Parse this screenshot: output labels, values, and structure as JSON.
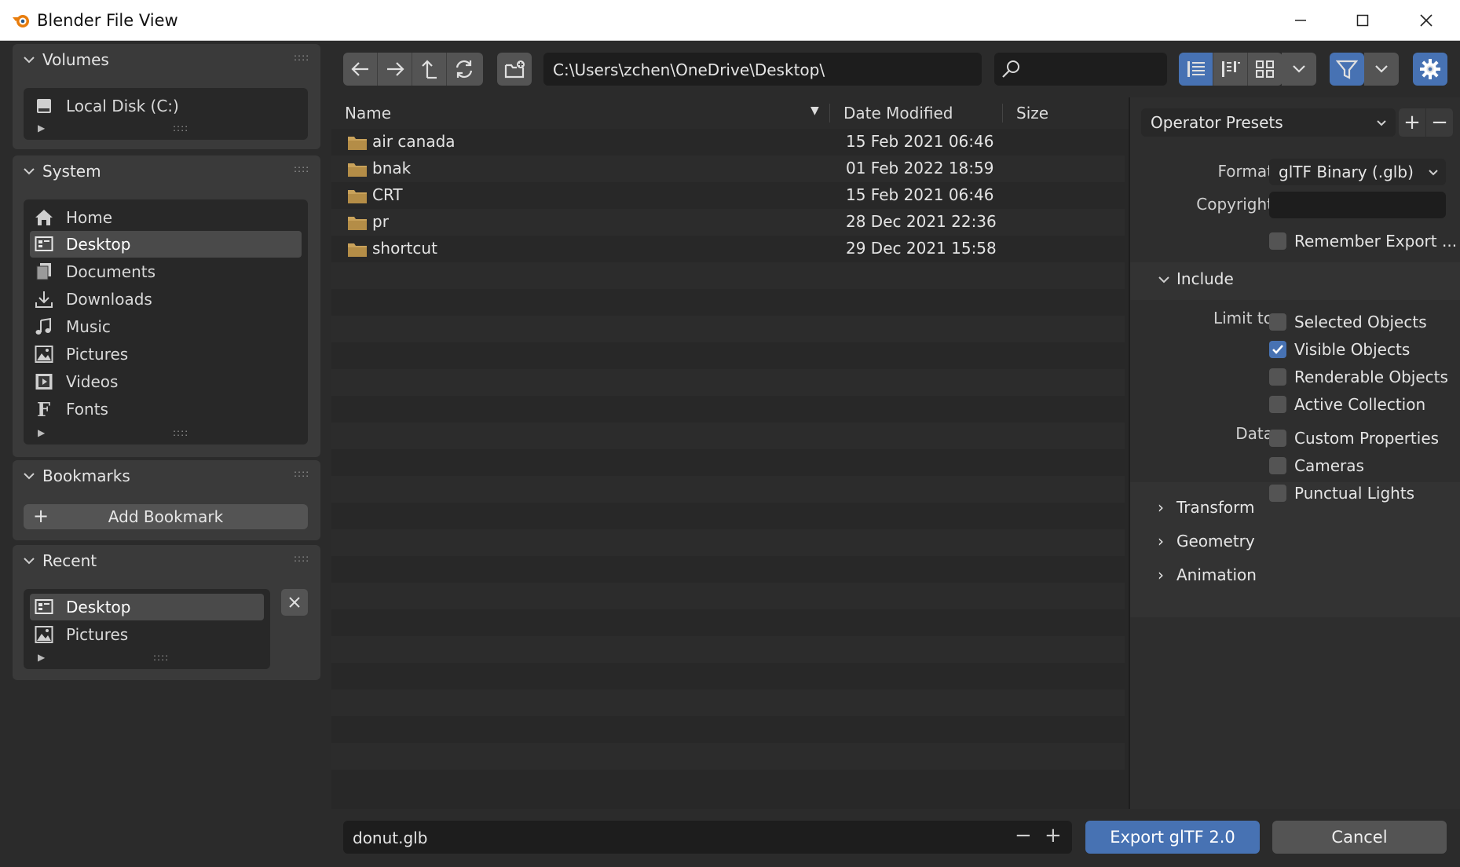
{
  "window": {
    "title": "Blender File View"
  },
  "sidebar": {
    "volumes": {
      "header": "Volumes",
      "items": [
        {
          "label": "Local Disk (C:)",
          "icon": "disk-icon"
        }
      ]
    },
    "system": {
      "header": "System",
      "items": [
        {
          "label": "Home",
          "icon": "home-icon"
        },
        {
          "label": "Desktop",
          "icon": "desktop-icon"
        },
        {
          "label": "Documents",
          "icon": "documents-icon"
        },
        {
          "label": "Downloads",
          "icon": "downloads-icon"
        },
        {
          "label": "Music",
          "icon": "music-icon"
        },
        {
          "label": "Pictures",
          "icon": "pictures-icon"
        },
        {
          "label": "Videos",
          "icon": "videos-icon"
        },
        {
          "label": "Fonts",
          "icon": "fonts-icon"
        }
      ],
      "selected": "Desktop"
    },
    "bookmarks": {
      "header": "Bookmarks",
      "add_label": "Add Bookmark"
    },
    "recent": {
      "header": "Recent",
      "items": [
        {
          "label": "Desktop",
          "icon": "desktop-icon"
        },
        {
          "label": "Pictures",
          "icon": "pictures-icon"
        }
      ],
      "selected": "Desktop"
    }
  },
  "toolbar": {
    "path": "C:\\Users\\zchen\\OneDrive\\Desktop\\",
    "search_value": ""
  },
  "filelist": {
    "columns": {
      "name": "Name",
      "date": "Date Modified",
      "size": "Size"
    },
    "rows": [
      {
        "name": "air canada",
        "date": "15 Feb 2021 06:46"
      },
      {
        "name": "bnak",
        "date": "01 Feb 2022 18:59"
      },
      {
        "name": "CRT",
        "date": "15 Feb 2021 06:46"
      },
      {
        "name": "pr",
        "date": "28 Dec 2021 22:36"
      },
      {
        "name": "shortcut",
        "date": "29 Dec 2021 15:58"
      }
    ]
  },
  "settings": {
    "operator_presets": "Operator Presets",
    "format_label": "Format",
    "format_value": "glTF Binary (.glb)",
    "copyright_label": "Copyright",
    "copyright_value": "",
    "remember_export": "Remember Export ...",
    "include": {
      "header": "Include",
      "limit_to_label": "Limit to",
      "limit_to": [
        {
          "label": "Selected Objects",
          "checked": false
        },
        {
          "label": "Visible Objects",
          "checked": true
        },
        {
          "label": "Renderable Objects",
          "checked": false
        },
        {
          "label": "Active Collection",
          "checked": false
        }
      ],
      "data_label": "Data",
      "data": [
        {
          "label": "Custom Properties",
          "checked": false
        },
        {
          "label": "Cameras",
          "checked": false
        },
        {
          "label": "Punctual Lights",
          "checked": false
        }
      ]
    },
    "sections": [
      "Transform",
      "Geometry",
      "Animation"
    ]
  },
  "bottom": {
    "filename": "donut.glb",
    "export_label": "Export glTF 2.0",
    "cancel_label": "Cancel"
  },
  "colors": {
    "accent": "#4772b3",
    "folder": "#c9a25a",
    "background": "#2b2b2b"
  }
}
